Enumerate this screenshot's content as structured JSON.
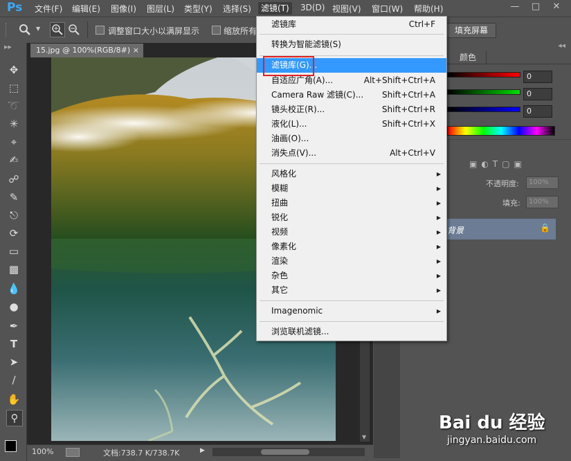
{
  "app": {
    "logo": "Ps"
  },
  "menubar": {
    "items": [
      "文件(F)",
      "编辑(E)",
      "图像(I)",
      "图层(L)",
      "类型(Y)",
      "选择(S)",
      "滤镜(T)",
      "3D(D)",
      "视图(V)",
      "窗口(W)",
      "帮助(H)"
    ]
  },
  "options": {
    "resize_label": "调整窗口大小以满屏显示",
    "zoom_all_label": "缩放所有",
    "fill_screen": "填充屏幕"
  },
  "document": {
    "tab_title": "15.jpg @ 100%(RGB/8#)",
    "close_glyph": "×",
    "zoom": "100%",
    "doc_info": "文档:738.7 K/738.7K"
  },
  "panels": {
    "color_tab": "颜色",
    "r_value": "0",
    "g_value": "0",
    "b_value": "0",
    "opacity_label": "不透明度:",
    "opacity_value": "100%",
    "fill_label": "填充:",
    "fill_value": "100%",
    "layer_name": "背景"
  },
  "filter_menu": {
    "items": [
      {
        "label": "滤镜库",
        "shortcut": "Ctrl+F"
      },
      {
        "label": "转换为智能滤镜(S)",
        "shortcut": ""
      },
      {
        "label": "滤镜库(G)...",
        "shortcut": ""
      },
      {
        "label": "自适应广角(A)...",
        "shortcut": "Alt+Shift+Ctrl+A"
      },
      {
        "label": "Camera Raw 滤镜(C)...",
        "shortcut": "Shift+Ctrl+A"
      },
      {
        "label": "镜头校正(R)...",
        "shortcut": "Shift+Ctrl+R"
      },
      {
        "label": "液化(L)...",
        "shortcut": "Shift+Ctrl+X"
      },
      {
        "label": "油画(O)...",
        "shortcut": ""
      },
      {
        "label": "消失点(V)...",
        "shortcut": "Alt+Ctrl+V"
      },
      {
        "label": "风格化",
        "shortcut": ""
      },
      {
        "label": "模糊",
        "shortcut": ""
      },
      {
        "label": "扭曲",
        "shortcut": ""
      },
      {
        "label": "锐化",
        "shortcut": ""
      },
      {
        "label": "视频",
        "shortcut": ""
      },
      {
        "label": "像素化",
        "shortcut": ""
      },
      {
        "label": "渲染",
        "shortcut": ""
      },
      {
        "label": "杂色",
        "shortcut": ""
      },
      {
        "label": "其它",
        "shortcut": ""
      },
      {
        "label": "Imagenomic",
        "shortcut": ""
      },
      {
        "label": "浏览联机滤镜...",
        "shortcut": ""
      }
    ]
  },
  "watermark": {
    "brand": "Bai du 经验",
    "url": "jingyan.baidu.com"
  },
  "colors": {
    "highlight": "#3399ff",
    "annotation_box": "#e02020",
    "ps_blue": "#3da8f4"
  }
}
